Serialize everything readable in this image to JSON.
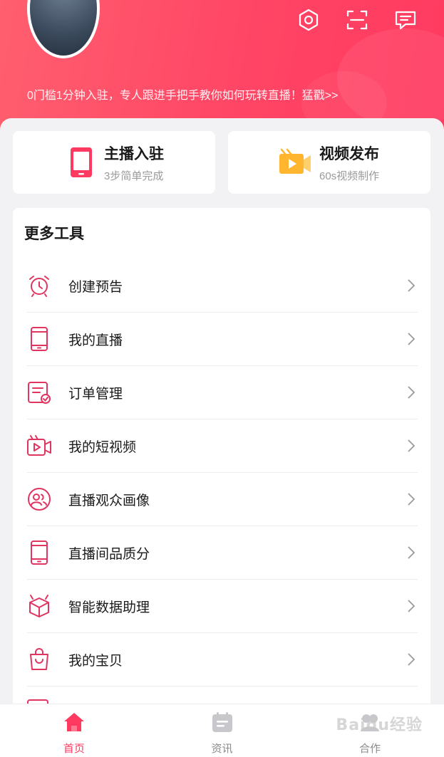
{
  "header": {
    "promo_text": "0门槛1分钟入驻，专人跟进手把手教你如何玩转直播！猛戳>>",
    "icons": [
      "settings-hexagon-icon",
      "scan-icon",
      "message-icon"
    ]
  },
  "quick_cards": [
    {
      "title": "主播入驻",
      "subtitle": "3步简单完成",
      "icon": "phone-icon"
    },
    {
      "title": "视频发布",
      "subtitle": "60s视频制作",
      "icon": "video-camera-icon"
    }
  ],
  "tools": {
    "title": "更多工具",
    "items": [
      {
        "label": "创建预告",
        "icon": "alarm-clock-icon"
      },
      {
        "label": "我的直播",
        "icon": "phone-icon"
      },
      {
        "label": "订单管理",
        "icon": "order-list-icon"
      },
      {
        "label": "我的短视频",
        "icon": "video-play-icon"
      },
      {
        "label": "直播观众画像",
        "icon": "audience-icon"
      },
      {
        "label": "直播间品质分",
        "icon": "phone-icon"
      },
      {
        "label": "智能数据助理",
        "icon": "robot-assistant-icon"
      },
      {
        "label": "我的宝贝",
        "icon": "shopping-bag-icon"
      }
    ]
  },
  "tabbar": {
    "items": [
      {
        "label": "首页",
        "icon": "home-icon",
        "active": true
      },
      {
        "label": "资讯",
        "icon": "news-icon",
        "active": false
      },
      {
        "label": "合作",
        "icon": "cooperate-icon",
        "active": false
      }
    ]
  },
  "watermark": "Baidu经验",
  "colors": {
    "brand": "#ff3a60",
    "accent_orange": "#ffb52e",
    "text_primary": "#1a1a1a",
    "text_secondary": "#9a9a9a"
  }
}
